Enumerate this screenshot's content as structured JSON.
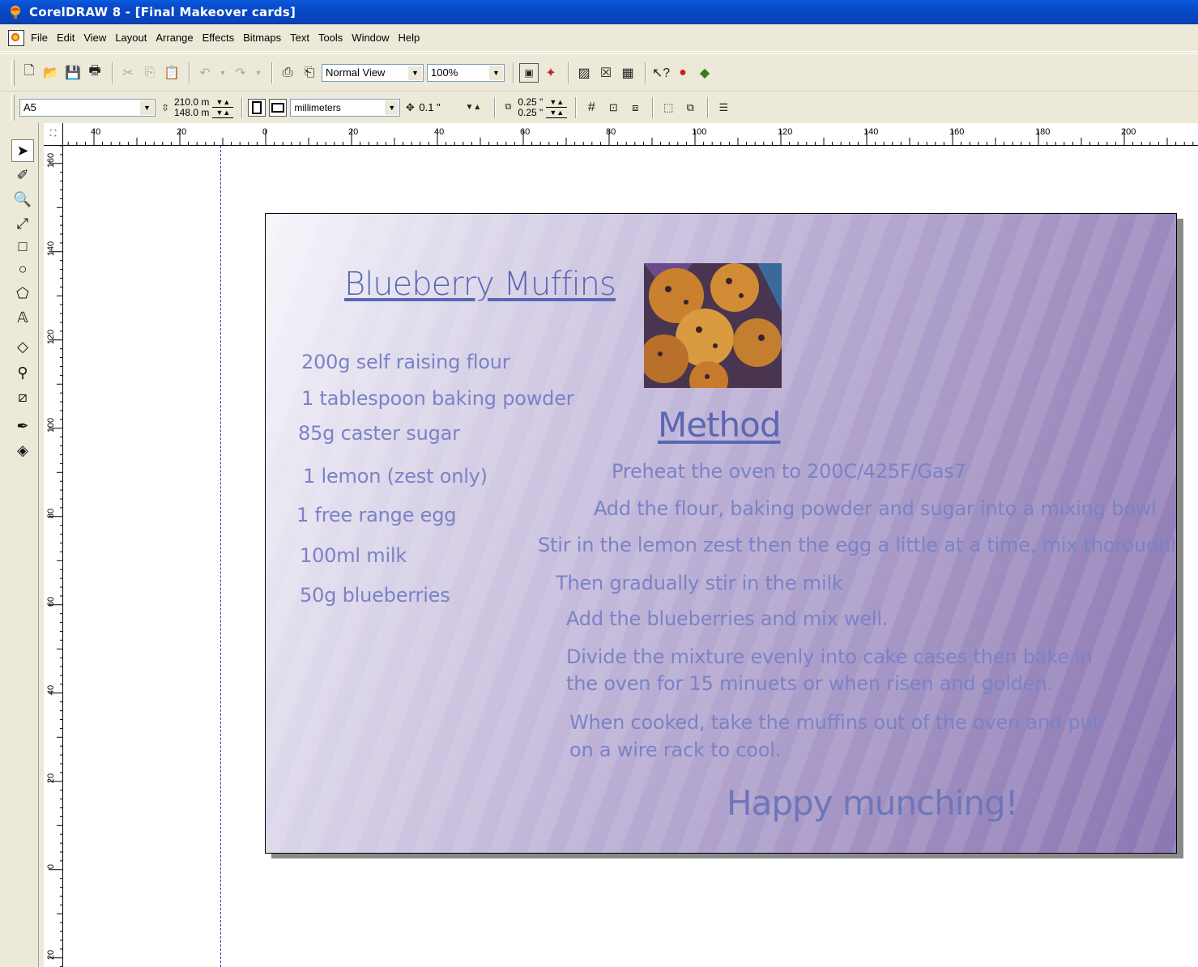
{
  "window": {
    "title": "CorelDRAW 8 - [Final Makeover cards]"
  },
  "menu": [
    "File",
    "Edit",
    "View",
    "Layout",
    "Arrange",
    "Effects",
    "Bitmaps",
    "Text",
    "Tools",
    "Window",
    "Help"
  ],
  "standard_toolbar": {
    "view_mode": "Normal View",
    "zoom": "100%"
  },
  "property_bar": {
    "paper_size": "A5",
    "width": "210.0 m",
    "height": "148.0 m",
    "units": "millimeters",
    "nudge": "0.1 \"",
    "dup_x": "0.25 \"",
    "dup_y": "0.25 \""
  },
  "rulers": {
    "horizontal_labels": [
      "40",
      "20",
      "0",
      "20",
      "40",
      "60",
      "80",
      "100",
      "120",
      "140",
      "160",
      "180",
      "200"
    ],
    "vertical_labels": [
      "160",
      "140",
      "120",
      "100",
      "80",
      "60",
      "40",
      "20",
      "0",
      "20"
    ]
  },
  "card": {
    "title": "Blueberry Muffins",
    "ingredients": [
      "200g self raising flour",
      "1 tablespoon baking powder",
      "85g caster sugar",
      "1 lemon (zest only)",
      "1 free range egg",
      "100ml milk",
      "50g blueberries"
    ],
    "method_title": "Method",
    "steps": [
      "Preheat the oven to 200C/425F/Gas7",
      "Add the flour, baking powder and sugar into a mixing bowl",
      "Stir in the lemon zest then the egg a little at a time, mix thoroughly",
      "Then gradually stir in the milk",
      "Add the blueberries and mix well.",
      "Divide the mixture evenly into cake cases then bake in",
      "the oven for 15 minuets or when risen and golden.",
      "When cooked, take the muffins out of the oven and put",
      "on a wire rack to cool."
    ],
    "closing": "Happy munching!",
    "photo_icon": "muffins-photo"
  },
  "colors": {
    "title_bar": "#0747c4",
    "card_gradient_start": "#f7f6fb",
    "card_gradient_end": "#8b76b2",
    "text": "#7b82c6",
    "guide": "#2a3fd0"
  }
}
